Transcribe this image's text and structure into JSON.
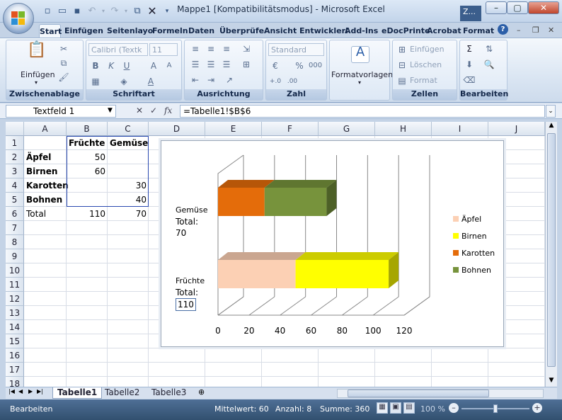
{
  "window": {
    "title": "Mappe1 [Kompatibilitätsmodus] - Microsoft Excel",
    "taskbar_label": "Z..."
  },
  "ribbon_tabs": [
    "Start",
    "Einfügen",
    "Seitenlayo",
    "Formeln",
    "Daten",
    "Überprüfe",
    "Ansicht",
    "Entwicklerl",
    "Add-Ins",
    "eDocPrinte",
    "Acrobat",
    "Format"
  ],
  "groups": {
    "clipboard": {
      "title": "Zwischenablage",
      "paste": "Einfügen"
    },
    "font": {
      "title": "Schriftart",
      "font_name": "Calibri (Textk",
      "font_size": "11"
    },
    "alignment": {
      "title": "Ausrichtung"
    },
    "number": {
      "title": "Zahl",
      "format": "Standard",
      "percent": "%",
      "thousands": "000"
    },
    "styles": {
      "title": "",
      "formatvorlagen": "Formatvorlagen"
    },
    "cells": {
      "title": "Zellen",
      "insert": "Einfügen",
      "delete": "Löschen",
      "format": "Format"
    },
    "editing": {
      "title": "Bearbeiten"
    }
  },
  "formula_bar": {
    "name_box": "Textfeld 1",
    "formula": "=Tabelle1!$B$6",
    "fx": "fx"
  },
  "columns": [
    "A",
    "B",
    "C",
    "D",
    "E",
    "F",
    "G",
    "H",
    "I",
    "J"
  ],
  "rows": [
    "1",
    "2",
    "3",
    "4",
    "5",
    "6",
    "7",
    "8",
    "9",
    "10",
    "11",
    "12",
    "13",
    "14",
    "15",
    "16",
    "17",
    "18"
  ],
  "cells": {
    "B1": "Früchte",
    "C1": "Gemüse",
    "A2": "Äpfel",
    "B2": "50",
    "A3": "Birnen",
    "B3": "60",
    "A4": "Karotten",
    "C4": "30",
    "A5": "Bohnen",
    "C5": "40",
    "A6": "Total",
    "B6": "110",
    "C6": "70"
  },
  "chart_data": {
    "type": "bar",
    "stacked": true,
    "three_d": true,
    "categories": [
      "Früchte",
      "Gemüse"
    ],
    "series": [
      {
        "name": "Äpfel",
        "values": [
          50,
          0
        ],
        "color": "#fcd0b4"
      },
      {
        "name": "Birnen",
        "values": [
          60,
          0
        ],
        "color": "#ffff00"
      },
      {
        "name": "Karotten",
        "values": [
          0,
          30
        ],
        "color": "#e46c0a"
      },
      {
        "name": "Bohnen",
        "values": [
          0,
          40
        ],
        "color": "#77933c"
      }
    ],
    "xlim": [
      0,
      120
    ],
    "x_ticks": [
      "0",
      "20",
      "40",
      "60",
      "80",
      "100",
      "120"
    ],
    "legend_position": "right",
    "category_labels": [
      {
        "category": "Früchte",
        "total_label": "Total:",
        "total_value": "110"
      },
      {
        "category": "Gemüse",
        "total_label": "Total:",
        "total_value": "70"
      }
    ]
  },
  "sheet_tabs": [
    "Tabelle1",
    "Tabelle2",
    "Tabelle3"
  ],
  "status": {
    "mode": "Bearbeiten",
    "average": "Mittelwert: 60",
    "count": "Anzahl: 8",
    "sum": "Summe: 360",
    "zoom": "100 %"
  }
}
